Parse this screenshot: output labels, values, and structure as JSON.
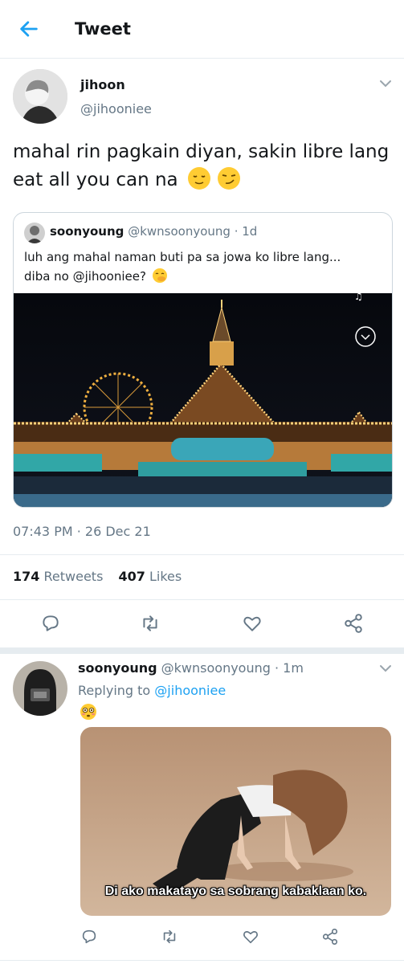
{
  "header": {
    "title": "Tweet"
  },
  "tweet": {
    "name": "jihoon",
    "handle": "@jihooniee",
    "text": "mahal rin pagkain diyan, sakin libre lang eat all you can na",
    "timestamp": "07:43 PM · 26 Dec 21",
    "retweets_count": "174",
    "retweets_label": "Retweets",
    "likes_count": "407",
    "likes_label": "Likes"
  },
  "quote": {
    "name": "soonyoung",
    "handle": "@kwnsoonyoung",
    "time": "· 1d",
    "text_line1": "luh ang mahal naman buti pa sa jowa ko libre lang...",
    "text_line2_prefix": "diba no ",
    "mention": "@jihooniee",
    "text_line2_suffix": "?"
  },
  "reply": {
    "name": "soonyoung",
    "handle": "@kwnsoonyoung",
    "time": "· 1m",
    "replying_prefix": "Replying to ",
    "replying_to": "@jihooniee",
    "image_caption": "Di ako makatayo sa sobrang kabaklaan ko."
  },
  "colors": {
    "accent": "#1da1f2",
    "secondary_text": "#657786",
    "divider": "#e6ecf0"
  },
  "icons": [
    "back-arrow-icon",
    "chevron-down-icon",
    "reply-icon",
    "retweet-icon",
    "like-icon",
    "share-icon",
    "relieved-face-emoji",
    "smirk-face-emoji",
    "hand-over-mouth-emoji",
    "flushed-face-emoji"
  ]
}
